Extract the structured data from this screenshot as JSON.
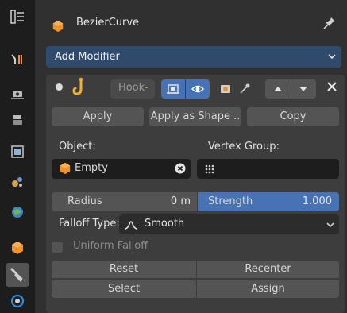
{
  "header": {
    "object_name": "BezierCurve",
    "pin_icon": "pin-icon"
  },
  "tabs": [
    {
      "name": "tool",
      "icon": "tool-icon",
      "active": false
    },
    {
      "name": "render",
      "icon": "render-icon",
      "active": false
    },
    {
      "name": "output",
      "icon": "output-icon",
      "active": false
    },
    {
      "name": "view-layer",
      "icon": "view-layer-icon",
      "active": false
    },
    {
      "name": "scene",
      "icon": "scene-icon",
      "active": false
    },
    {
      "name": "world",
      "icon": "world-icon",
      "active": false
    },
    {
      "name": "object",
      "icon": "object-icon",
      "active": false
    },
    {
      "name": "modifiers",
      "icon": "wrench-icon",
      "active": true
    },
    {
      "name": "particles",
      "icon": "particles-icon",
      "active": false
    }
  ],
  "add_modifier": {
    "label": "Add Modifier"
  },
  "modifier": {
    "name_value": "Hook-",
    "apply_label": "Apply",
    "apply_as_shape_label": "Apply as Shape ..",
    "copy_label": "Copy",
    "object_label": "Object:",
    "vertex_group_label": "Vertex Group:",
    "object_value": "Empty",
    "radius_label": "Radius",
    "radius_value": "0 m",
    "strength_label": "Strength",
    "strength_value": "1.000",
    "falloff_type_label": "Falloff Type:",
    "falloff_type_value": "Smooth",
    "uniform_falloff_label": "Uniform Falloff",
    "uniform_falloff_checked": false,
    "reset_label": "Reset",
    "recenter_label": "Recenter",
    "select_label": "Select",
    "assign_label": "Assign",
    "show_in_editmode": true,
    "show_viewport": true,
    "show_render": false,
    "show_on_cage": false
  },
  "colors": {
    "accent_blue": "#4772b3",
    "add_modifier_bg": "#2f4a6a",
    "object_orange": "#f0922a"
  }
}
